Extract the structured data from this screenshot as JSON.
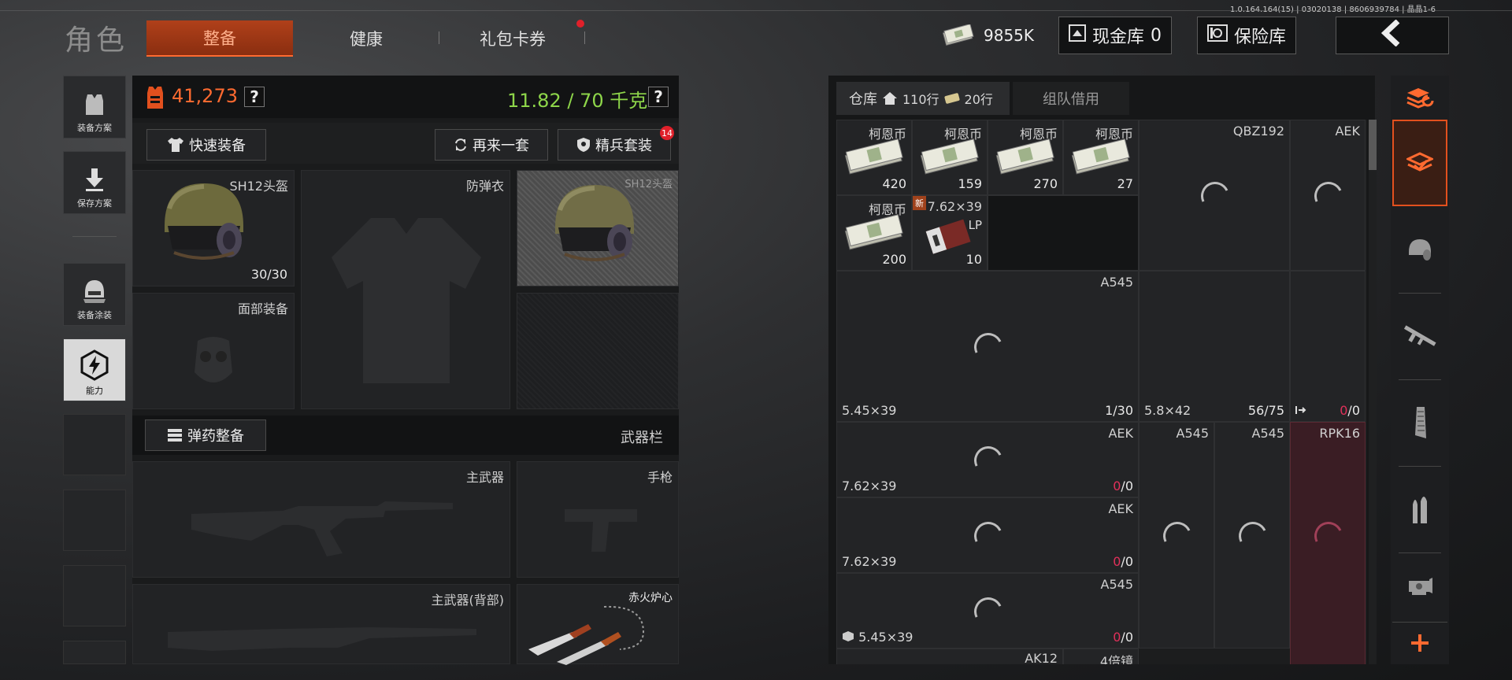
{
  "version": "1.0.164.164(15) | 03020138 | 8606939784 | 晶晶1-6",
  "header": {
    "title": "角色",
    "tabs": [
      {
        "label": "整备",
        "active": true
      },
      {
        "label": "健康",
        "active": false
      },
      {
        "label": "礼包卡券",
        "active": false,
        "badge_dot": true
      }
    ],
    "money": "9855K",
    "cash_vault_label": "现金库",
    "cash_vault_value": "0",
    "safe_label": "保险库",
    "back_icon": "chevron-left-icon"
  },
  "left_sidebar": {
    "items": [
      {
        "label": "装备方案",
        "icon": "vest-icon"
      },
      {
        "label": "保存方案",
        "icon": "download-icon"
      },
      {
        "label": "装备涂装",
        "icon": "helmet-paint-icon"
      },
      {
        "label": "能力",
        "icon": "energy-hex-icon",
        "active": true
      }
    ]
  },
  "loadout": {
    "value": "41,273",
    "weight_current": "11.82",
    "weight_max": "70",
    "weight_unit": "千克",
    "help": "?",
    "quick_equip": "快速装备",
    "reroll": "再来一套",
    "elite_set": "精兵套装",
    "elite_badge": "14",
    "helmet_name": "SH12头盔",
    "helmet_durability": "30/30",
    "armor_label": "防弹衣",
    "helmet_ghost_name": "SH12头盔",
    "face_label": "面部装备",
    "ammo_btn": "弹药整备",
    "weapon_bar": "武器栏",
    "primary_label": "主武器",
    "pistol_label": "手枪",
    "primary_back_label": "主武器(背部)",
    "melee_label": "赤火炉心"
  },
  "storage": {
    "tab_label": "仓库",
    "rows_house": "110行",
    "rows_ticket": "20行",
    "team_label": "组队借用",
    "cash_items": [
      {
        "name": "柯恩币",
        "count": "420"
      },
      {
        "name": "柯恩币",
        "count": "159"
      },
      {
        "name": "柯恩币",
        "count": "270"
      },
      {
        "name": "柯恩币",
        "count": "27"
      },
      {
        "name": "柯恩币",
        "count": "200"
      }
    ],
    "ammo_item": {
      "name": "7.62×39",
      "sub": "LP",
      "count": "10",
      "new_badge": "新"
    },
    "weapons": [
      {
        "name": "QBZ192"
      },
      {
        "name": "AEK"
      },
      {
        "name": "A545",
        "caliber": "5.45×39",
        "count": "1/30"
      },
      {
        "caliber": "5.8×42",
        "count": "56/75"
      },
      {
        "count_a": "0",
        "count_b": "/0"
      },
      {
        "name": "AEK",
        "caliber": "7.62×39",
        "count_a": "0",
        "count_b": "/0"
      },
      {
        "name": "A545"
      },
      {
        "name": "A545"
      },
      {
        "name": "RPK16"
      },
      {
        "name": "AEK",
        "caliber": "7.62×39",
        "count_a": "0",
        "count_b": "/0"
      },
      {
        "name": "A545",
        "caliber": "5.45×39",
        "count_a": "0",
        "count_b": "/0"
      },
      {
        "name": "AK12"
      },
      {
        "name": "4倍镜"
      }
    ]
  },
  "right_bar": {
    "icons": [
      "layers-sort-icon",
      "storage-stack-icon",
      "helmet-icon",
      "rifle-icon",
      "magazine-icon",
      "bullet-icon",
      "scope-icon",
      "add-icon"
    ]
  },
  "colors": {
    "accent_orange": "#ff6a30",
    "weight_green": "#8ed64a",
    "warn_red": "#e0305a"
  }
}
